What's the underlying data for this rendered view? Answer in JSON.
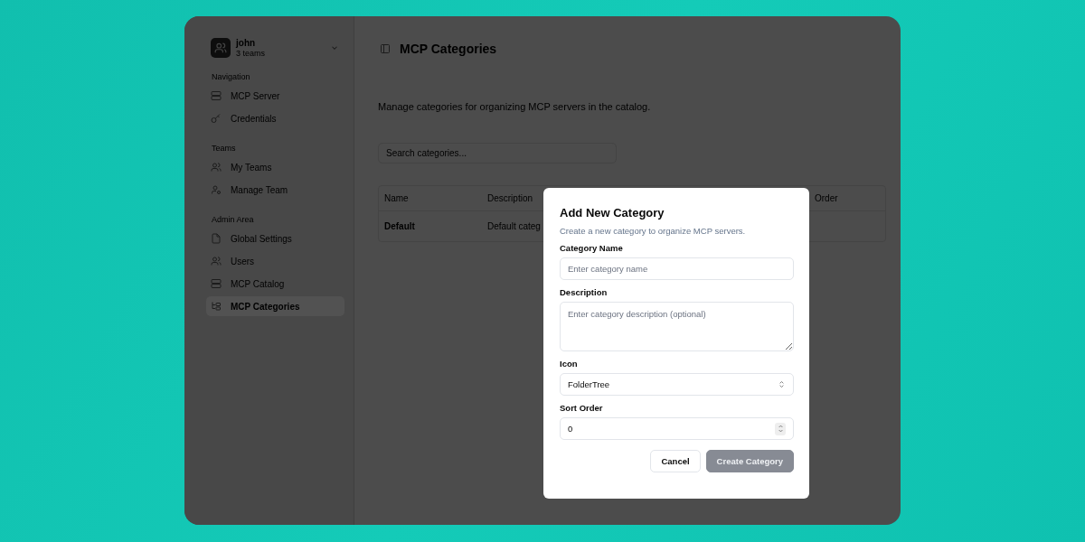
{
  "sidebar": {
    "user": {
      "name": "john",
      "subtitle": "3 teams"
    },
    "sections": [
      {
        "label": "Navigation",
        "items": [
          {
            "label": "MCP Server",
            "selected": false
          },
          {
            "label": "Credentials",
            "selected": false
          }
        ]
      },
      {
        "label": "Teams",
        "items": [
          {
            "label": "My Teams",
            "selected": false
          },
          {
            "label": "Manage Team",
            "selected": false
          }
        ]
      },
      {
        "label": "Admin Area",
        "items": [
          {
            "label": "Global Settings",
            "selected": false
          },
          {
            "label": "Users",
            "selected": false
          },
          {
            "label": "MCP Catalog",
            "selected": false
          },
          {
            "label": "MCP Categories",
            "selected": true
          }
        ]
      }
    ]
  },
  "main": {
    "title": "MCP Categories",
    "description": "Manage categories for organizing MCP servers in the catalog.",
    "search": {
      "placeholder": "Search categories..."
    },
    "table": {
      "columns": [
        "Name",
        "Description",
        "Order"
      ],
      "rows": [
        {
          "cells": [
            "Default",
            "Default categ"
          ]
        }
      ]
    }
  },
  "dialog": {
    "title": "Add New Category",
    "subtitle": "Create a new category to organize MCP servers.",
    "fields": [
      {
        "kind": "text",
        "label": "Category Name",
        "placeholder": "Enter category name"
      },
      {
        "kind": "textarea",
        "label": "Description",
        "placeholder": "Enter category description (optional)"
      },
      {
        "kind": "select",
        "label": "Icon",
        "value": "FolderTree"
      },
      {
        "kind": "number",
        "label": "Sort Order",
        "value": "0"
      }
    ],
    "buttons": [
      {
        "label": "Cancel",
        "kind": "secondary",
        "disabled": false
      },
      {
        "label": "Create Category",
        "kind": "primary",
        "disabled": true
      }
    ]
  }
}
